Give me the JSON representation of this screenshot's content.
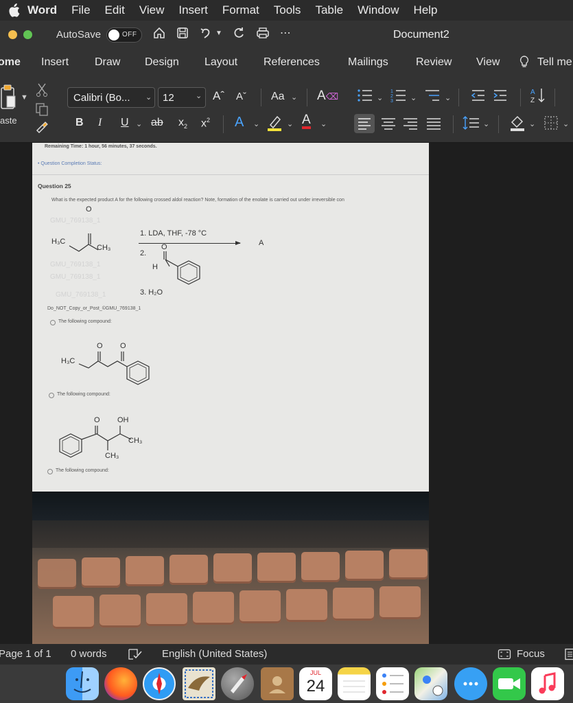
{
  "menubar": {
    "app_name": "Word",
    "items": [
      "File",
      "Edit",
      "View",
      "Insert",
      "Format",
      "Tools",
      "Table",
      "Window",
      "Help"
    ]
  },
  "titlebar": {
    "autosave_label": "AutoSave",
    "autosave_state": "OFF",
    "document_title": "Document2"
  },
  "tabs": [
    "ome",
    "Insert",
    "Draw",
    "Design",
    "Layout",
    "References",
    "Mailings",
    "Review",
    "View",
    "Tell me"
  ],
  "ribbon": {
    "font_name": "Calibri (Bo...",
    "font_size": "12",
    "grow_font": "Aˆ",
    "shrink_font": "Aˇ",
    "case_label": "Aa",
    "bold": "B",
    "italic": "I",
    "underline": "U",
    "strike": "ab",
    "subscript": "x",
    "superscript": "x",
    "text_effects": "A",
    "font_color": "A",
    "paste_label": "aste"
  },
  "paper": {
    "remaining_time": "Remaining Time: 1 hour, 56 minutes, 37 seconds.",
    "completion_status": "• Question Completion Status:",
    "question_heading": "Question 25",
    "question_text": "What is the expected product A for the following crossed aldol reaction? Note, formation of the enolate is carried out under irreversible con",
    "watermark_1": "GMU_769138_1",
    "watermark_2": "GMU_769138_1",
    "watermark_3": "GMU_769138_1",
    "watermark_4": "GMU_769138_1",
    "reagent_1": "1. LDA, THF, -78 °C",
    "reagent_2": "2.",
    "reagent_3": "3. H₂O",
    "product_label": "A",
    "h3c_label": "H₃C",
    "ch3_label": "CH₃",
    "o_label": "O",
    "h_label": "H",
    "copy_notice": "Do_NOT_Copy_or_Post_©GMU_769138_1",
    "option_1": "The following compound:",
    "option_2": "The following compound:",
    "option_3": "The following compound:",
    "oh_label": "OH"
  },
  "statusbar": {
    "page": "Page 1 of 1",
    "words": "0 words",
    "language": "English (United States)",
    "focus": "Focus"
  },
  "dock": {
    "calendar_month": "JUL",
    "calendar_day": "24"
  },
  "colors": {
    "close": "#ed6a5e",
    "minimize": "#f5bf4f",
    "zoom": "#61c554",
    "accent_red": "#e0272e",
    "highlight": "#f5e23a",
    "effects_blue": "#4aa3ff"
  }
}
